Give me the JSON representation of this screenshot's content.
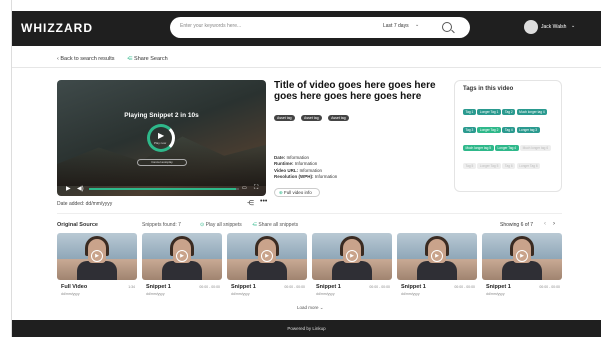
{
  "header": {
    "logo": "WHIZZARD",
    "search_placeholder": "Enter your keywords here...",
    "date_range": "Last 7 days",
    "user_name": "Jack Walsh"
  },
  "subnav": {
    "back_label": "Back to search results",
    "share_label": "Share Search"
  },
  "player": {
    "playing_text": "Playing Snippet 2 in 10s",
    "ring_label": "Play now",
    "cancel_label": "Cancel autoplay",
    "progress": 0.98,
    "date_added": "Date added: dd/mm/yyyy"
  },
  "video": {
    "title": "Title of video goes here goes here goes here goes here goes here",
    "tags": [
      "Asset tag",
      "Asset tag",
      "Asset tag"
    ],
    "info": [
      {
        "label": "Date:",
        "value": "Information"
      },
      {
        "label": "Runtime:",
        "value": "Information"
      },
      {
        "label": "Video URL:",
        "value": "Information"
      },
      {
        "label": "Resolution (WPH):",
        "value": "Information"
      }
    ],
    "full_info_label": "Full video info"
  },
  "tags_panel": {
    "title": "Tags in this video",
    "tags": [
      {
        "label": "Tag 1",
        "style": "blue"
      },
      {
        "label": "Longer Tag 1",
        "style": "blue"
      },
      {
        "label": "Tag 2",
        "style": "blue"
      },
      {
        "label": "Much longer tag 4",
        "style": "blue"
      },
      {
        "label": "Tag 3",
        "style": "blue"
      },
      {
        "label": "Longer Tag 2",
        "style": "green"
      },
      {
        "label": "Tag 4",
        "style": "blue"
      },
      {
        "label": "Longer tag 3",
        "style": "blue"
      },
      {
        "label": "Much longer tag 5",
        "style": "green"
      },
      {
        "label": "Longer Tag 4",
        "style": "green"
      },
      {
        "label": "Much longer tag 6",
        "style": "faded"
      },
      {
        "label": "Tag 5",
        "style": "faded"
      },
      {
        "label": "Longer Tag 5",
        "style": "faded"
      },
      {
        "label": "Tag 6",
        "style": "faded"
      },
      {
        "label": "Longer Tag 6",
        "style": "faded"
      }
    ]
  },
  "snippets_bar": {
    "original_source": "Original Source",
    "found": "Snippets found: 7",
    "play_all": "Play all snippets",
    "share_all": "Share all snippets",
    "showing": "Showing 6 of 7"
  },
  "cards": [
    {
      "title": "Full Video",
      "time": "1:34",
      "date": "dd/mm/yyyy"
    },
    {
      "title": "Snippet 1",
      "time": "00:00 - 00:00",
      "date": "dd/mm/yyyy"
    },
    {
      "title": "Snippet 1",
      "time": "00:00 - 00:00",
      "date": "dd/mm/yyyy"
    },
    {
      "title": "Snippet 1",
      "time": "00:00 - 00:00",
      "date": "dd/mm/yyyy"
    },
    {
      "title": "Snippet 1",
      "time": "00:00 - 00:00",
      "date": "dd/mm/yyyy"
    },
    {
      "title": "Snippet 1",
      "time": "00:00 - 00:00",
      "date": "dd/mm/yyyy"
    }
  ],
  "load_more": "Load more",
  "footer": "Powered by Linkup",
  "colors": {
    "accent": "#2eb88a",
    "dark": "#1f1f1f"
  }
}
